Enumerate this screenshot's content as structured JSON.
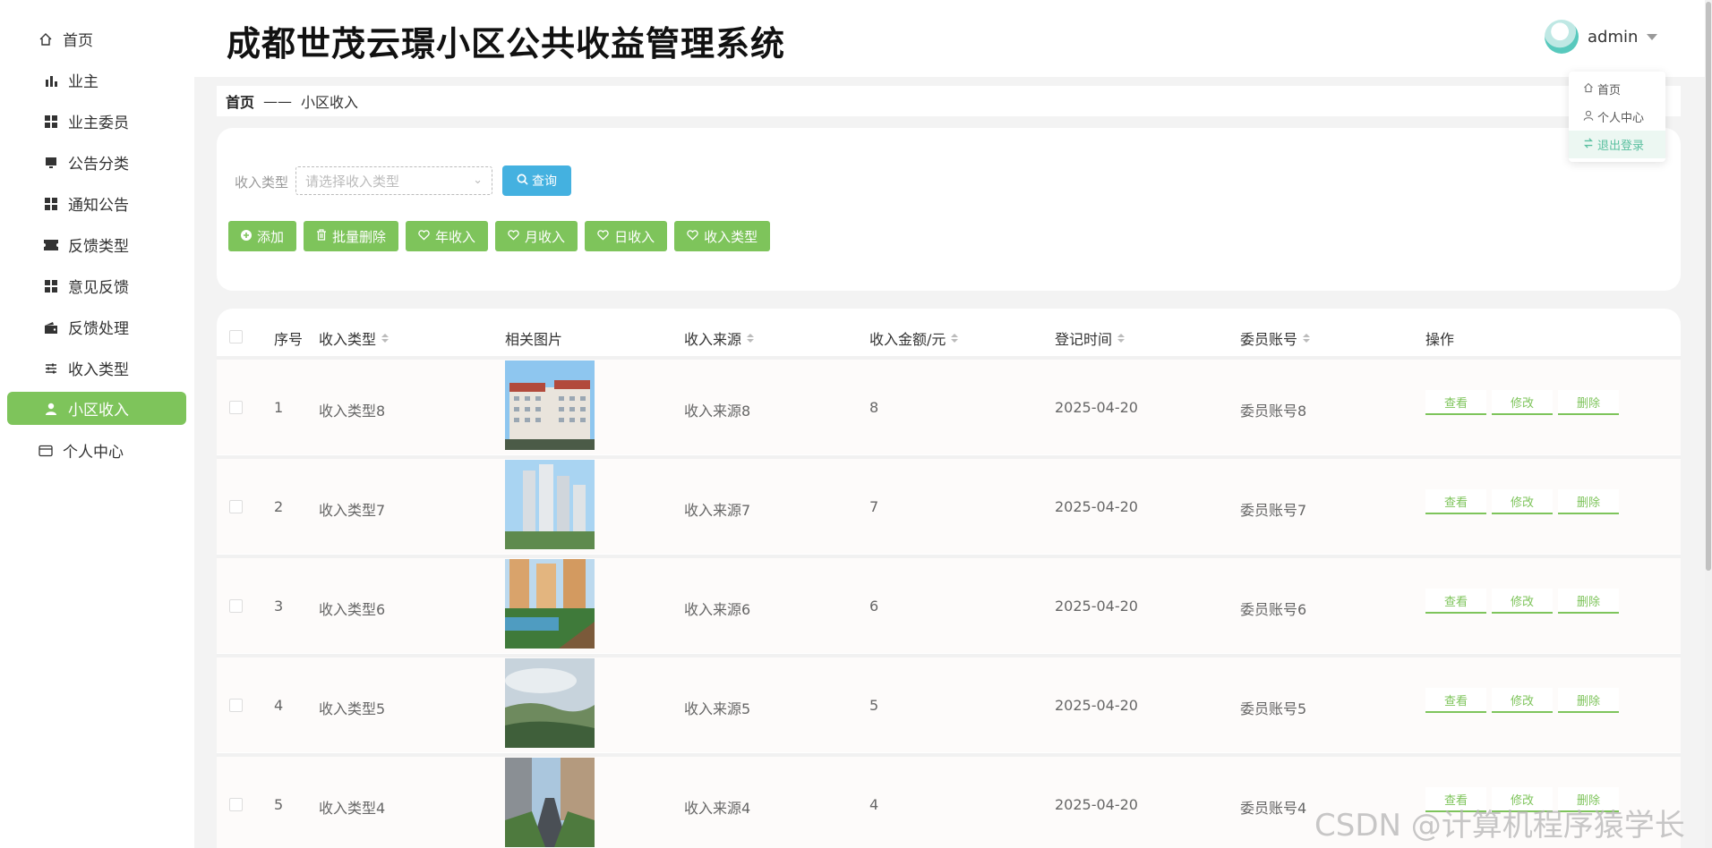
{
  "app": {
    "title": "成都世茂云璟小区公共收益管理系统"
  },
  "header": {
    "username": "admin"
  },
  "dropdown": {
    "items": [
      {
        "label": "首页",
        "icon": "home-icon"
      },
      {
        "label": "个人中心",
        "icon": "user-icon"
      },
      {
        "label": "退出登录",
        "icon": "logout-icon"
      }
    ]
  },
  "sidebar": {
    "home": "首页",
    "items": [
      {
        "label": "业主",
        "icon": "bar-chart-icon"
      },
      {
        "label": "业主委员",
        "icon": "grid-icon"
      },
      {
        "label": "公告分类",
        "icon": "monitor-icon"
      },
      {
        "label": "通知公告",
        "icon": "grid-icon"
      },
      {
        "label": "反馈类型",
        "icon": "ticket-icon"
      },
      {
        "label": "意见反馈",
        "icon": "grid-icon"
      },
      {
        "label": "反馈处理",
        "icon": "wallet-icon"
      },
      {
        "label": "收入类型",
        "icon": "sliders-icon"
      },
      {
        "label": "小区收入",
        "icon": "user-icon",
        "active": true
      }
    ],
    "personal": "个人中心"
  },
  "breadcrumb": {
    "home": "首页",
    "sep": "——",
    "current": "小区收入"
  },
  "search": {
    "label": "收入类型",
    "placeholder": "请选择收入类型",
    "query_button": "查询"
  },
  "actions": {
    "add": "添加",
    "batch_delete": "批量删除",
    "year_income": "年收入",
    "month_income": "月收入",
    "day_income": "日收入",
    "income_type": "收入类型"
  },
  "table": {
    "headers": {
      "index": "序号",
      "type": "收入类型",
      "image": "相关图片",
      "source": "收入来源",
      "amount": "收入金额/元",
      "time": "登记时间",
      "account": "委员账号",
      "ops": "操作"
    },
    "row_actions": {
      "view": "查看",
      "edit": "修改",
      "delete": "删除"
    },
    "rows": [
      {
        "index": "1",
        "type": "收入类型8",
        "source": "收入来源8",
        "amount": "8",
        "time": "2025-04-20",
        "account": "委员账号8"
      },
      {
        "index": "2",
        "type": "收入类型7",
        "source": "收入来源7",
        "amount": "7",
        "time": "2025-04-20",
        "account": "委员账号7"
      },
      {
        "index": "3",
        "type": "收入类型6",
        "source": "收入来源6",
        "amount": "6",
        "time": "2025-04-20",
        "account": "委员账号6"
      },
      {
        "index": "4",
        "type": "收入类型5",
        "source": "收入来源5",
        "amount": "5",
        "time": "2025-04-20",
        "account": "委员账号5"
      },
      {
        "index": "5",
        "type": "收入类型4",
        "source": "收入来源4",
        "amount": "4",
        "time": "2025-04-20",
        "account": "委员账号4"
      }
    ]
  },
  "watermark": "CSDN @计算机程序猿学长",
  "colors": {
    "accent": "#7ec45b",
    "query": "#44b1e0",
    "dropdown_hover": "#5bc0a0"
  }
}
